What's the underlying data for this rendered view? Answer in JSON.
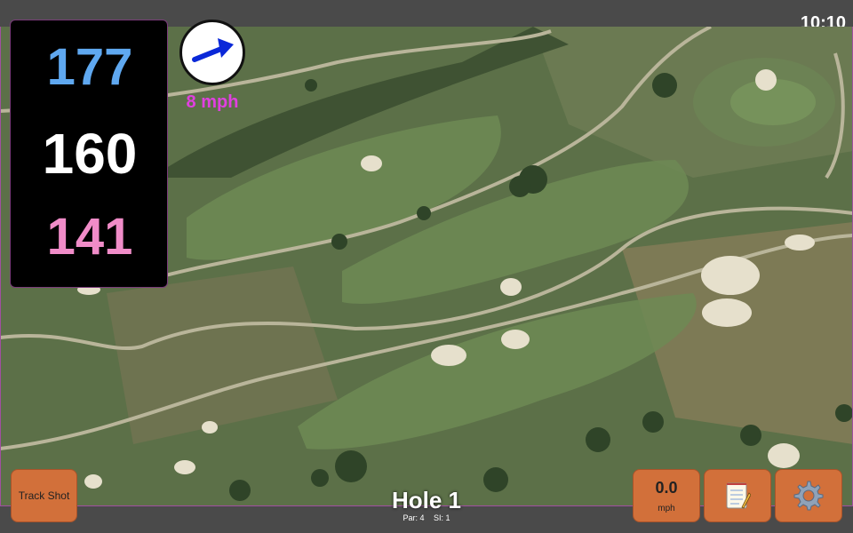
{
  "status_bar": {
    "time": "10:10"
  },
  "yardages": {
    "back": "177",
    "middle": "160",
    "front": "141",
    "back_color": "#5fa8f0",
    "middle_color": "#ffffff",
    "front_color": "#f08cc8"
  },
  "wind": {
    "speed_label": "8 mph",
    "direction_icon": "arrow-icon",
    "arrow_color": "#0a28d8"
  },
  "track_shot": {
    "label": "Track Shot"
  },
  "hole": {
    "title": "Hole 1",
    "par_label": "Par: 4",
    "si_label": "SI: 1"
  },
  "shot_speed": {
    "value": "0.0",
    "unit": "mph"
  },
  "buttons": {
    "notes_icon": "notepad-icon",
    "settings_icon": "gear-icon",
    "accent": "#d2703a"
  }
}
